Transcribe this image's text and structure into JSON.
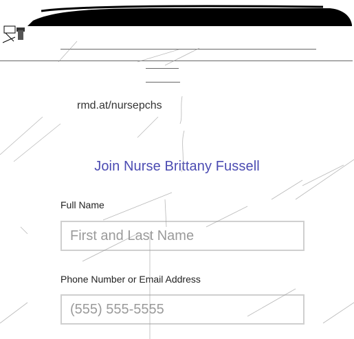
{
  "short_link": "rmd.at/nursepchs",
  "form": {
    "heading": "Join Nurse Brittany Fussell",
    "full_name": {
      "label": "Full Name",
      "placeholder": "First and Last Name",
      "value": ""
    },
    "contact": {
      "label": "Phone Number or Email Address",
      "placeholder": "(555) 555-5555",
      "value": ""
    }
  },
  "colors": {
    "heading": "#4b4bb2",
    "input_border": "#cfcfcf",
    "banner": "#000000"
  }
}
